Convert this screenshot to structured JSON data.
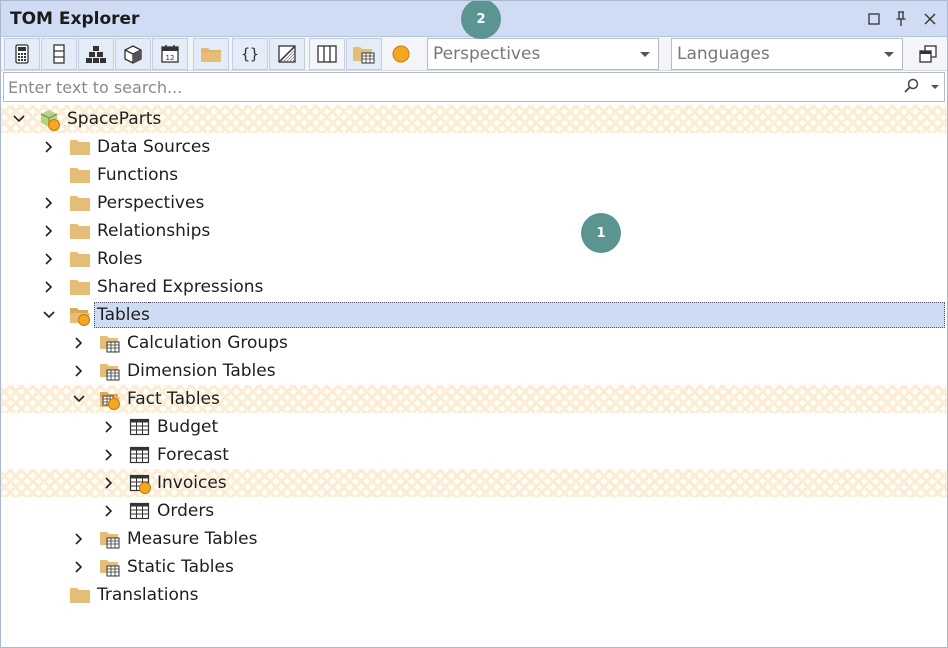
{
  "window": {
    "title": "TOM Explorer"
  },
  "callouts": {
    "one": "1",
    "two": "2"
  },
  "toolbar": {
    "perspectives_dropdown": {
      "value": "Perspectives"
    },
    "languages_dropdown": {
      "value": "Languages"
    }
  },
  "search": {
    "placeholder": "Enter text to search..."
  },
  "tree": {
    "model": "SpaceParts",
    "data_sources": "Data Sources",
    "functions": "Functions",
    "perspectives": "Perspectives",
    "relationships": "Relationships",
    "roles": "Roles",
    "shared_expressions": "Shared Expressions",
    "tables": "Tables",
    "calculation_groups": "Calculation Groups",
    "dimension_tables": "Dimension Tables",
    "fact_tables": "Fact Tables",
    "budget": "Budget",
    "forecast": "Forecast",
    "invoices": "Invoices",
    "orders": "Orders",
    "measure_tables": "Measure Tables",
    "static_tables": "Static Tables",
    "translations": "Translations"
  },
  "colors": {
    "titlebar": "#cfdcf3",
    "selection": "#cddcf2",
    "callout": "#5b9592",
    "changed_marker": "#f5a623",
    "folder": "#e6bd78"
  }
}
